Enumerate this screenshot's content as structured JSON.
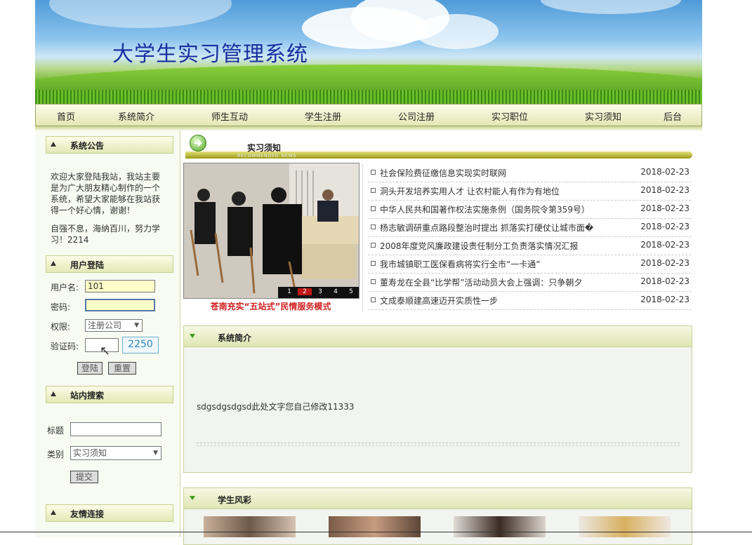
{
  "site": {
    "title": "大学生实习管理系统"
  },
  "nav": {
    "items": [
      "首页",
      "系统简介",
      "师生互动",
      "学生注册",
      "公司注册",
      "实习职位",
      "实习须知",
      "后台"
    ]
  },
  "sidebar": {
    "announcement": {
      "title": "系统公告",
      "text1": "欢迎大家登陆我站，我站主要是为广大朋友精心制作的一个系统，希望大家能够在我站获得一个好心情，谢谢！",
      "text2": "自强不息，海纳百川，努力学习！2214"
    },
    "login": {
      "title": "用户登陆",
      "username_label": "用户名:",
      "username_value": "101",
      "password_label": "密码:",
      "password_value": "",
      "role_label": "权限:",
      "role_value": "注册公司",
      "captcha_label": "验证码:",
      "captcha_code": "2250",
      "login_button": "登陆",
      "reset_button": "重置"
    },
    "search": {
      "title": "站内搜索",
      "title_label": "标题",
      "title_value": "",
      "category_label": "类别",
      "category_value": "实习须知",
      "submit_button": "提交"
    },
    "links": {
      "title": "友情连接"
    }
  },
  "news": {
    "title": "实习须知",
    "subtitle": "RECOMMENDED NEWS",
    "caption": "苍南充实“五站式”民情服务模式",
    "slides": [
      "1",
      "2",
      "3",
      "4",
      "5"
    ],
    "items": [
      {
        "title": "社会保险费征缴信息实现实时联网",
        "date": "2018-02-23"
      },
      {
        "title": "洞头开发培养实用人才 让农村能人有作为有地位",
        "date": "2018-02-23"
      },
      {
        "title": "中华人民共和国著作权法实施条例（国务院令第359号）",
        "date": "2018-02-23"
      },
      {
        "title": "杨志敏调研重点路段整治时提出 抓落实打硬仗让城市面�",
        "date": "2018-02-23"
      },
      {
        "title": "2008年度党风廉政建设责任制分工负责落实情况汇报",
        "date": "2018-02-23"
      },
      {
        "title": "我市城镇职工医保看病将实行全市“一卡通”",
        "date": "2018-02-23"
      },
      {
        "title": "董寿龙在全县“比学帮”活动动员大会上强调：只争朝夕",
        "date": "2018-02-23"
      },
      {
        "title": "文成泰顺建高速迈开实质性一步",
        "date": "2018-02-23"
      }
    ]
  },
  "intro": {
    "title": "系统简介",
    "text": "sdgsdgsdgsd此处文字您自己修改11333"
  },
  "students": {
    "title": "学生风彩"
  }
}
